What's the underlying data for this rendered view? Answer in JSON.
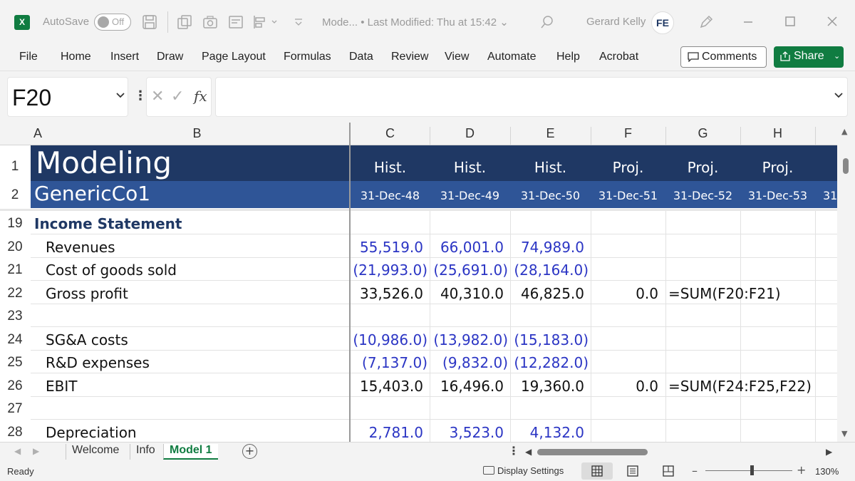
{
  "titlebar": {
    "app_logo": "X",
    "autosave_label": "AutoSave",
    "autosave_state": "Off",
    "document_title": "Mode...  •  Last Modified: Thu at 15:42  ⌄",
    "user_name": "Gerard Kelly",
    "user_initials": "FE"
  },
  "ribbon": {
    "tabs": [
      "File",
      "Home",
      "Insert",
      "Draw",
      "Page Layout",
      "Formulas",
      "Data",
      "Review",
      "View",
      "Automate",
      "Help",
      "Acrobat"
    ],
    "comments_label": "Comments",
    "share_label": "Share"
  },
  "formula_bar": {
    "name_box": "F20",
    "formula": ""
  },
  "grid": {
    "columns": [
      "A",
      "B",
      "C",
      "D",
      "E",
      "F",
      "G",
      "H"
    ],
    "header_rows": [
      "1",
      "2"
    ],
    "title": "Modeling",
    "subtitle": "GenericCo1",
    "period_types": [
      "Hist.",
      "Hist.",
      "Hist.",
      "Proj.",
      "Proj.",
      "Proj."
    ],
    "period_dates": [
      "31-Dec-48",
      "31-Dec-49",
      "31-Dec-50",
      "31-Dec-51",
      "31-Dec-52",
      "31-Dec-53",
      "31"
    ],
    "rows": [
      {
        "num": "19",
        "label": "Income Statement"
      },
      {
        "num": "20",
        "label": "Revenues",
        "c": "55,519.0",
        "d": "66,001.0",
        "e": "74,989.0"
      },
      {
        "num": "21",
        "label": "Cost of goods sold",
        "c": "(21,993.0)",
        "d": "(25,691.0)",
        "e": "(28,164.0)"
      },
      {
        "num": "22",
        "label": "Gross profit",
        "c": "33,526.0",
        "d": "40,310.0",
        "e": "46,825.0",
        "f": "0.0",
        "g": "=SUM(F20:F21)"
      },
      {
        "num": "23",
        "label": ""
      },
      {
        "num": "24",
        "label": "SG&A costs",
        "c": "(10,986.0)",
        "d": "(13,982.0)",
        "e": "(15,183.0)"
      },
      {
        "num": "25",
        "label": "R&D expenses",
        "c": "(7,137.0)",
        "d": "(9,832.0)",
        "e": "(12,282.0)"
      },
      {
        "num": "26",
        "label": "EBIT",
        "c": "15,403.0",
        "d": "16,496.0",
        "e": "19,360.0",
        "f": "0.0",
        "g": "=SUM(F24:F25,F22)"
      },
      {
        "num": "27",
        "label": ""
      },
      {
        "num": "28",
        "label": "Depreciation",
        "c": "2,781.0",
        "d": "3,523.0",
        "e": "4,132.0"
      }
    ],
    "colors": {
      "title_band": "#1f3864",
      "subtitle_band": "#2f5597",
      "input_blue": "#2b35c4",
      "excel_green": "#107c41"
    }
  },
  "sheets": {
    "tabs": [
      "Welcome",
      "Info",
      "Model 1"
    ],
    "active": "Model 1"
  },
  "statusbar": {
    "status": "Ready",
    "display_settings": "Display Settings",
    "zoom": "130%",
    "zoom_minus": "–",
    "zoom_plus": "+"
  }
}
